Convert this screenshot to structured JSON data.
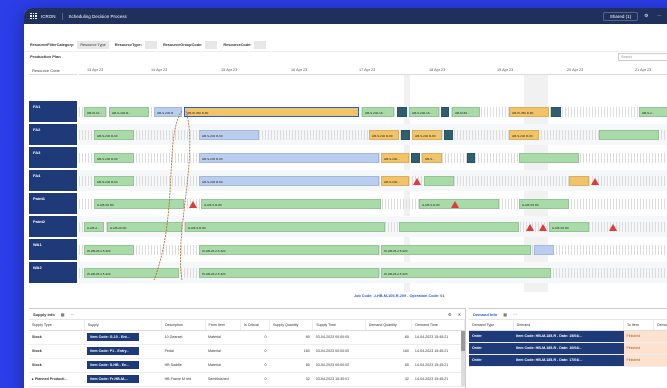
{
  "app": {
    "logo": "ICRON",
    "title": "Scheduling Decision Process",
    "shared": "Shared (1)",
    "btn_settings": "⚙",
    "btn_more": "⋯",
    "btn_window": "▭"
  },
  "filters": [
    {
      "label": "ResourceFilterCategory:",
      "value": "Resource Type"
    },
    {
      "label": "ResourceType:",
      "value": ""
    },
    {
      "label": "ResourceGroupCode:",
      "value": ""
    },
    {
      "label": "ResourceCode:",
      "value": ""
    }
  ],
  "plan": {
    "title": "Production Plan",
    "search_placeholder": "Search"
  },
  "gantt": {
    "column_header": "Resource Code",
    "ticks": [
      "13 Apr 23",
      "14 Apr 23",
      "15 Apr 23",
      "16 Apr 23",
      "17 Apr 23",
      "18 Apr 23",
      "19 Apr 23",
      "20 Apr 23",
      "21 Apr 23"
    ],
    "resources": [
      "FA1",
      "FA2",
      "FA3",
      "FA4",
      "Paint1",
      "Paint2",
      "WA1",
      "WA2"
    ],
    "labels": {
      "fa1_a": "HB-W-10...",
      "fa1_b": "HB-S-240-R...",
      "fa1_c": "HB-S-240 R",
      "fa1_main": "HB-W-350 R-80",
      "fa1_d": "HB-S-240-16...",
      "fa1_e": "HB-S-240-16...",
      "fa1_f": "HB-M-50...",
      "fa1_g": "HB-W-350 R-80",
      "fa1_h": "HB-S-2...",
      "fa2_a": "HB-S-240 R-90",
      "fa2_b": "HB-S-240 R-90",
      "fa2_c": "HB-S-240 R-80",
      "fa2_d": "HB-S-240 R-80",
      "fa2_e": "HB-S-240 R-80",
      "fa3_a": "HB-S-240 R-90",
      "fa3_b": "HB-S-240 R-80",
      "fa3_c": "HB-S-240...",
      "fa3_d": "HB-S...",
      "fa4_a": "HB-S-240 R-90",
      "fa4_b": "HB-S-240 R-80",
      "fa4_c": "HB-S-240...",
      "p1_a": "H-HB-S5 R0",
      "p1_b": "H-HB-S R-80",
      "p1_c": "H-HB-S R-80",
      "p1_d": "H-HB-S5 R0",
      "p2_a": "H-HB-2...",
      "p2_b": "H-HB-26 R0",
      "p2_c": "H-HB-S R-80",
      "p2_d": "H-HB-S5 R0",
      "wa1_a": "W-HB-26-2.5-320",
      "wa1_b": "W-HB-26-2.5-320",
      "wa1_c": "W-HB-26-2.5-320",
      "wa2_a": "W-HB-26-2.5-320",
      "wa2_b": "W-HB-26-2.5-320",
      "wa2_c": "W-HB-26-2.5-320"
    },
    "op_info": "Job Code: J-HB-M-105-R-209 - Operation Code: 01"
  },
  "supply": {
    "tab_title": "Supply Info",
    "columns": [
      "Supply Type",
      "Supply",
      "Description",
      "From Item",
      "Is Critical",
      "Supply Quantity",
      "Supply Time",
      "Demand Quantity",
      "Demand Time"
    ],
    "rows": [
      {
        "type": "Stock",
        "supply": "Item Code: G-10 - Ent...",
        "description": "10 Gearset",
        "from_item": "Material",
        "critical": "0",
        "supply_qty": "80",
        "supply_time": "03-04-2023 00:00:00",
        "demand_qty": "80",
        "demand_time": "14-04-2023 15:45:21"
      },
      {
        "type": "Stock",
        "supply": "Item Code: P1 - Entry...",
        "description": "Pedal",
        "from_item": "Material",
        "critical": "0",
        "supply_qty": "160",
        "supply_time": "03-04-2023 00:00:00",
        "demand_qty": "160",
        "demand_time": "14-04-2023 15:45:21"
      },
      {
        "type": "Stock",
        "supply": "Item Code: S-HB - En...",
        "description": "HB Saddle",
        "from_item": "Material",
        "critical": "0",
        "supply_qty": "80",
        "supply_time": "03-04-2023 00:00:00",
        "demand_qty": "80",
        "demand_time": "14-04-2023 15:45:21"
      },
      {
        "type": "Planned Producti...",
        "supply": "Item Code: Fr-HB-M-...",
        "description": "HB Frame M red",
        "from_item": "Semifinished",
        "critical": "0",
        "supply_qty": "32",
        "supply_time": "03-04-2023 15:30:01",
        "demand_qty": "32",
        "demand_time": "14-04-2023 15:45:21"
      }
    ]
  },
  "demand": {
    "tab_title": "Demand Info",
    "columns": [
      "Demand Type",
      "Demand",
      "To Item",
      "Dema..."
    ],
    "rows": [
      {
        "type": "Order",
        "demand": "Item Code: HB-M-185-R - Date: 15/04/...",
        "to_item": "Finished"
      },
      {
        "type": "Order",
        "demand": "Item Code: HB-M-185-R - Date: 16/04/...",
        "to_item": "Finished"
      },
      {
        "type": "Order",
        "demand": "Item Code: HB-M-185-R - Date: 17/04/...",
        "to_item": "Finished"
      }
    ]
  }
}
